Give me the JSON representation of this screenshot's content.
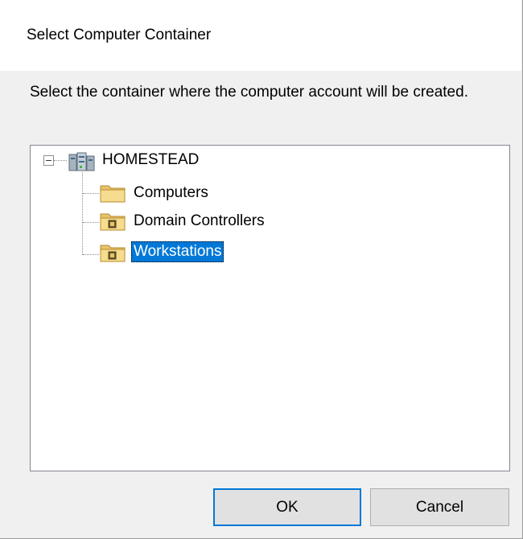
{
  "dialog": {
    "title": "Select Computer Container",
    "instruction": "Select the container where the computer account will be created."
  },
  "tree": {
    "root": {
      "label": "HOMESTEAD",
      "icon": "domain-icon",
      "expanded": true
    },
    "children": [
      {
        "label": "Computers",
        "icon": "folder-icon",
        "selected": false
      },
      {
        "label": "Domain Controllers",
        "icon": "ou-folder-icon",
        "selected": false
      },
      {
        "label": "Workstations",
        "icon": "ou-folder-icon",
        "selected": true
      }
    ]
  },
  "buttons": {
    "ok_label": "OK",
    "cancel_label": "Cancel"
  },
  "colors": {
    "selection": "#0078d7",
    "dialog_bg": "#f0f0f0",
    "button_bg": "#e1e1e1"
  }
}
